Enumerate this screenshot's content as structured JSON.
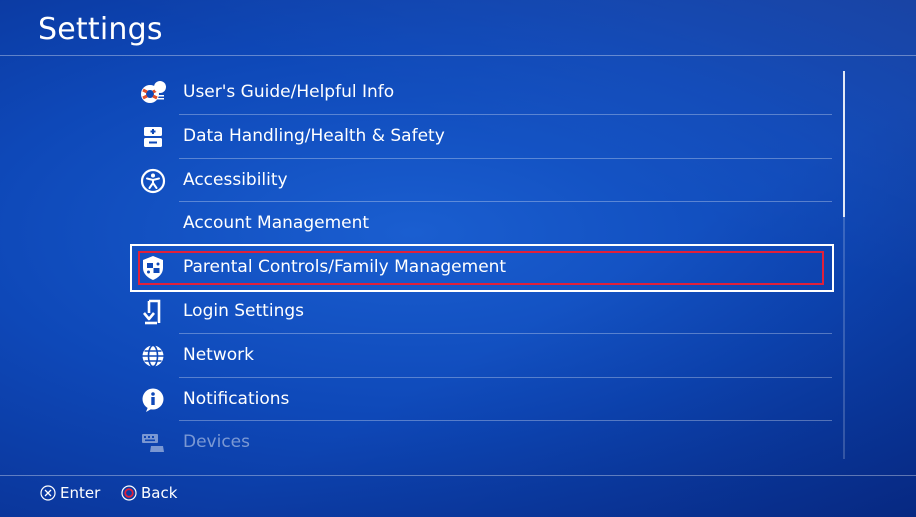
{
  "header": {
    "title": "Settings"
  },
  "menu": {
    "items": [
      {
        "label": "User's Guide/Helpful Info",
        "icon": "lifebuoy-info-icon"
      },
      {
        "label": "Data Handling/Health & Safety",
        "icon": "health-safety-icon"
      },
      {
        "label": "Accessibility",
        "icon": "accessibility-icon"
      },
      {
        "label": "Account Management",
        "icon": ""
      },
      {
        "label": "Parental Controls/Family Management",
        "icon": "family-shield-icon",
        "selected": true
      },
      {
        "label": "Login Settings",
        "icon": "login-arrow-icon"
      },
      {
        "label": "Network",
        "icon": "globe-icon"
      },
      {
        "label": "Notifications",
        "icon": "info-bubble-icon"
      },
      {
        "label": "Devices",
        "icon": "keyboard-controller-icon"
      }
    ]
  },
  "footer": {
    "enter_label": "Enter",
    "back_label": "Back"
  },
  "colors": {
    "background": "#0e48b8",
    "highlight": "#e0203a",
    "text": "#ffffff"
  }
}
